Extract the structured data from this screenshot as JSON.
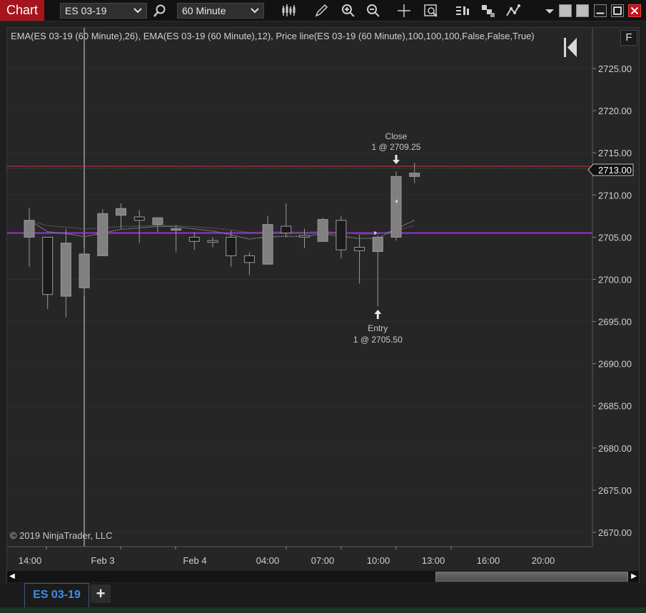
{
  "toolbar": {
    "chart_label": "Chart",
    "instrument": "ES 03-19",
    "interval": "60 Minute",
    "icons": [
      "search-icon",
      "bar-type-icon",
      "pencil-icon",
      "zoom-in-icon",
      "zoom-out-icon",
      "crosshair-icon",
      "data-box-icon",
      "strategy-icon",
      "properties-icon",
      "indicators-icon",
      "dropdown-arrow-icon",
      "minimize-icon",
      "maximize-icon",
      "close-icon"
    ]
  },
  "chart": {
    "indicator_label": "EMA(ES 03-19 (60 Minute),26), EMA(ES 03-19 (60 Minute),12), Price line(ES 03-19 (60 Minute),100,100,100,False,False,True)",
    "f_button": "F",
    "copyright": "© 2019 NinjaTrader, LLC",
    "last_price_label": "2713.00",
    "close_marker_title": "Close",
    "close_marker_detail": "1 @ 2709.25",
    "entry_marker_title": "Entry",
    "entry_marker_detail": "1 @ 2705.50",
    "colors": {
      "background": "#262626",
      "price_line": "#9b30d8",
      "last_price_line": "#c0392b",
      "bar_up": "#808080",
      "bar_down": "#1a1a1a"
    }
  },
  "chart_data": {
    "type": "candlestick",
    "y_ticks": [
      "2725.00",
      "2720.00",
      "2715.00",
      "2710.00",
      "2705.00",
      "2700.00",
      "2695.00",
      "2690.00",
      "2685.00",
      "2680.00",
      "2675.00",
      "2670.00"
    ],
    "ylim": [
      2669,
      2729
    ],
    "x_ticks": [
      "14:00",
      "Feb 3",
      "Feb 4",
      "04:00",
      "07:00",
      "10:00",
      "13:00",
      "16:00",
      "20:00"
    ],
    "price_line": 2705.5,
    "last_price": 2713.0,
    "candles": [
      {
        "o": 2705,
        "h": 2708.5,
        "l": 2701.5,
        "c": 2707
      },
      {
        "o": 2705,
        "h": 2705,
        "l": 2696.5,
        "c": 2698.2
      },
      {
        "o": 2698,
        "h": 2706,
        "l": 2695.5,
        "c": 2704.3
      },
      {
        "o": 2699,
        "h": 2703.7,
        "l": 2698,
        "c": 2703
      },
      {
        "o": 2702.8,
        "h": 2708.3,
        "l": 2702.8,
        "c": 2707.8
      },
      {
        "o": 2707.6,
        "h": 2709,
        "l": 2706,
        "c": 2708.4
      },
      {
        "o": 2707.4,
        "h": 2708.2,
        "l": 2704.3,
        "c": 2707
      },
      {
        "o": 2706.5,
        "h": 2707.2,
        "l": 2705.6,
        "c": 2707.3
      },
      {
        "o": 2706,
        "h": 2706.4,
        "l": 2703.3,
        "c": 2706
      },
      {
        "o": 2705,
        "h": 2705.6,
        "l": 2703.5,
        "c": 2704.5
      },
      {
        "o": 2704.6,
        "h": 2705,
        "l": 2703.8,
        "c": 2704.4
      },
      {
        "o": 2705,
        "h": 2705.8,
        "l": 2701.5,
        "c": 2702.8
      },
      {
        "o": 2702.8,
        "h": 2703.2,
        "l": 2700.5,
        "c": 2702
      },
      {
        "o": 2701.8,
        "h": 2707.5,
        "l": 2701.8,
        "c": 2706.5
      },
      {
        "o": 2706.3,
        "h": 2709,
        "l": 2705,
        "c": 2705.5
      },
      {
        "o": 2705.2,
        "h": 2706,
        "l": 2703.7,
        "c": 2705
      },
      {
        "o": 2704.5,
        "h": 2707.3,
        "l": 2704.5,
        "c": 2707.1
      },
      {
        "o": 2707,
        "h": 2707.5,
        "l": 2702.5,
        "c": 2703.5
      },
      {
        "o": 2703.8,
        "h": 2705.3,
        "l": 2699.5,
        "c": 2703.4
      },
      {
        "o": 2703.3,
        "h": 2705.2,
        "l": 2696.8,
        "c": 2705
      },
      {
        "o": 2705,
        "h": 2712.8,
        "l": 2704.6,
        "c": 2712.2
      },
      {
        "o": 2712.2,
        "h": 2713.8,
        "l": 2711.4,
        "c": 2712.6
      }
    ]
  },
  "scrollbar": {
    "left_arrow": "◀",
    "right_arrow": "▶"
  },
  "tabs": {
    "active": "ES 03-19",
    "add": "+"
  }
}
